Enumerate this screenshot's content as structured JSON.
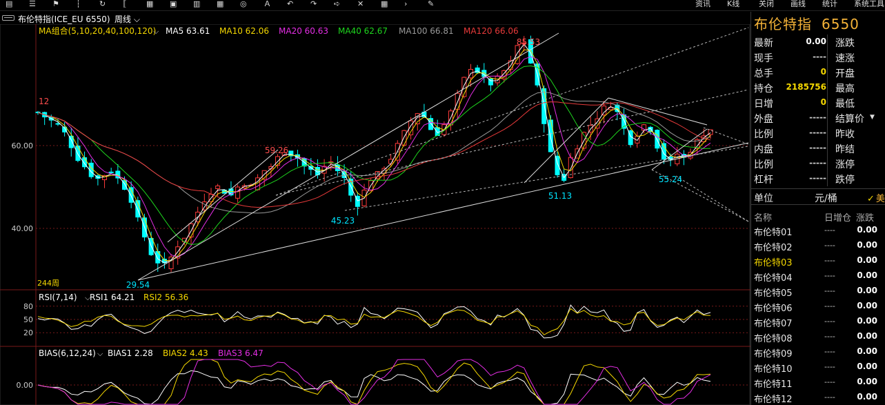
{
  "toolbar": {
    "icons": [
      "menu-icon",
      "list-icon",
      "flag-icon",
      "ruler-icon",
      "cycle-icon",
      "bracket-icon",
      "calendar-icon",
      "doc-icon",
      "chart-icon",
      "grid-icon",
      "bulb-icon",
      "text-icon",
      "undo-icon",
      "redo-icon",
      "arrow-icon",
      "cross-icon",
      "table-icon",
      "next-icon",
      "pen-icon"
    ],
    "right_items": [
      "资讯",
      "K线",
      "关闭",
      "画线",
      "统计",
      "系统工具"
    ]
  },
  "titlebar": {
    "symbol": "布伦特指(ICE_EU 6550)",
    "period": "周线"
  },
  "chart_data": [
    {
      "type": "candlestick",
      "panel": "main",
      "indicator_label": "MA组合(5,10,20,40,100,120)",
      "ma_legend": [
        {
          "name": "MA5",
          "value": "63.61",
          "color": "#ffffff"
        },
        {
          "name": "MA10",
          "value": "62.06",
          "color": "#f5d800"
        },
        {
          "name": "MA20",
          "value": "60.63",
          "color": "#e52ee5"
        },
        {
          "name": "MA40",
          "value": "62.67",
          "color": "#1ed61e"
        },
        {
          "name": "MA100",
          "value": "66.81",
          "color": "#9a9a9a"
        },
        {
          "name": "MA120",
          "value": "66.06",
          "color": "#e83a3a"
        }
      ],
      "y_ticks": [
        "60.00",
        "40.00"
      ],
      "ylim": [
        26,
        88
      ],
      "bars_count_label": "244周",
      "annotations": [
        {
          "text": "29.54",
          "value": 29.54,
          "color": "#00e5ff"
        },
        {
          "text": "59.26",
          "value": 59.26,
          "color": "#ff4d4d"
        },
        {
          "text": "45.23",
          "value": 45.23,
          "color": "#00e5ff"
        },
        {
          "text": "85.53",
          "value": 85.53,
          "color": "#ff4d4d"
        },
        {
          "text": "51.13",
          "value": 51.13,
          "color": "#00e5ff"
        },
        {
          "text": "55.24",
          "value": 55.24,
          "color": "#00e5ff"
        },
        {
          "text": "12",
          "value": 72,
          "color": "#ff4d4d"
        }
      ],
      "close_path": [
        68,
        67,
        66,
        65,
        63,
        60,
        57,
        55,
        53,
        52,
        53,
        54,
        52,
        50,
        47,
        42,
        38,
        34,
        32,
        31,
        33,
        36,
        38,
        41,
        44,
        47,
        49,
        50,
        49,
        48,
        50,
        51,
        50,
        52,
        54,
        55,
        57,
        59,
        58,
        57,
        55,
        54,
        53,
        55,
        56,
        54,
        52,
        48,
        46,
        49,
        52,
        53,
        55,
        57,
        60,
        63,
        66,
        68,
        67,
        64,
        63,
        65,
        68,
        72,
        76,
        79,
        78,
        76,
        75,
        76,
        78,
        80,
        84,
        85,
        80,
        74,
        66,
        58,
        53,
        52,
        57,
        60,
        63,
        65,
        67,
        69,
        70,
        68,
        64,
        61,
        63,
        65,
        64,
        60,
        57,
        56,
        58,
        57,
        59,
        61,
        63,
        64
      ]
    },
    {
      "type": "line",
      "panel": "rsi",
      "indicator_label": "RSI(7,14)",
      "series": [
        {
          "name": "RSI1",
          "value": "64.21",
          "color": "#ffffff"
        },
        {
          "name": "RSI2",
          "value": "56.36",
          "color": "#f5d800"
        }
      ],
      "y_ticks": [
        "80",
        "50",
        "20"
      ],
      "ylim": [
        0,
        100
      ]
    },
    {
      "type": "line",
      "panel": "bias",
      "indicator_label": "BIAS(6,12,24)",
      "series": [
        {
          "name": "BIAS1",
          "value": "2.28",
          "color": "#ffffff"
        },
        {
          "name": "BIAS2",
          "value": "4.43",
          "color": "#f5d800"
        },
        {
          "name": "BIAS3",
          "value": "6.47",
          "color": "#e52ee5"
        }
      ],
      "y_ticks": [
        "0.00"
      ]
    }
  ],
  "panel": {
    "title": "布伦特指",
    "code": "6550",
    "quote_rows": [
      {
        "l1": "最新",
        "v1": "0.00",
        "v1_color": "#ffffff",
        "l2": "涨跌",
        "v2": "",
        "v2_color": "#ffffff"
      },
      {
        "l1": "现手",
        "v1": "----",
        "v1_color": "#cccccc",
        "l2": "速涨",
        "v2": "",
        "v2_color": "#ffffff"
      },
      {
        "l1": "总手",
        "v1": "0",
        "v1_color": "#f5d800",
        "l2": "开盘",
        "v2": "",
        "v2_color": "#ffffff"
      },
      {
        "l1": "持仓",
        "v1": "2185756",
        "v1_color": "#f5d800",
        "l2": "最高",
        "v2": "",
        "v2_color": "#ffffff"
      },
      {
        "l1": "日增",
        "v1": "0",
        "v1_color": "#f5d800",
        "l2": "最低",
        "v2": "",
        "v2_color": "#ffffff"
      },
      {
        "l1": "外盘",
        "v1": "-----",
        "v1_color": "#cccccc",
        "l2": "结算价",
        "v2": "",
        "v2_color": "#ffffff"
      },
      {
        "l1": "比例",
        "v1": "-----",
        "v1_color": "#cccccc",
        "l2": "昨收",
        "v2": "",
        "v2_color": "#ffffff"
      },
      {
        "l1": "内盘",
        "v1": "-----",
        "v1_color": "#cccccc",
        "l2": "昨结",
        "v2": "",
        "v2_color": "#ffffff"
      },
      {
        "l1": "比例",
        "v1": "-----",
        "v1_color": "#cccccc",
        "l2": "涨停",
        "v2": "",
        "v2_color": "#ffffff"
      },
      {
        "l1": "杠杆",
        "v1": "-----",
        "v1_color": "#cccccc",
        "l2": "跌停",
        "v2": "",
        "v2_color": "#ffffff"
      }
    ],
    "unit_label": "单位",
    "unit_value": "元/桶",
    "currency": "美",
    "list_headers": [
      "名称",
      "日增仓",
      "涨跌"
    ],
    "contracts": [
      {
        "name": "布伦特01",
        "dz": "----",
        "zd": "0.00"
      },
      {
        "name": "布伦特02",
        "dz": "----",
        "zd": "0.00"
      },
      {
        "name": "布伦特03",
        "dz": "----",
        "zd": "0.00"
      },
      {
        "name": "布伦特04",
        "dz": "----",
        "zd": "0.00"
      },
      {
        "name": "布伦特05",
        "dz": "----",
        "zd": "0.00"
      },
      {
        "name": "布伦特06",
        "dz": "----",
        "zd": "0.00"
      },
      {
        "name": "布伦特07",
        "dz": "----",
        "zd": "0.00"
      },
      {
        "name": "布伦特08",
        "dz": "----",
        "zd": "0.00"
      },
      {
        "name": "布伦特09",
        "dz": "----",
        "zd": "0.00"
      },
      {
        "name": "布伦特10",
        "dz": "----",
        "zd": "0.00"
      },
      {
        "name": "布伦特11",
        "dz": "----",
        "zd": "0.00"
      },
      {
        "name": "布伦特12",
        "dz": "----",
        "zd": "0.00"
      }
    ],
    "active_index": 2
  },
  "colors": {
    "up": "#ff3b3b",
    "down": "#00ffff",
    "grid": "#7a1a1a",
    "trendline": "#ffffff"
  }
}
